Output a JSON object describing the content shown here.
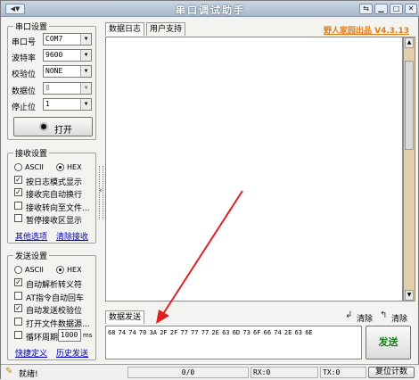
{
  "window": {
    "title": "串口调试助手",
    "sysmenu": "◀▼"
  },
  "serial": {
    "group_title": "串口设置",
    "port_label": "串口号",
    "port_value": "COM7",
    "baud_label": "波特率",
    "baud_value": "9600",
    "parity_label": "校验位",
    "parity_value": "NONE",
    "data_label": "数据位",
    "data_value": "8",
    "stop_label": "停止位",
    "stop_value": "1",
    "open_button": "打开"
  },
  "receive": {
    "group_title": "接收设置",
    "ascii": "ASCII",
    "hex": "HEX",
    "opt1": "按日志模式显示",
    "opt2": "接收完自动换行",
    "opt3": "接收转向至文件...",
    "opt4": "暂停接收区显示",
    "more": "其他选项",
    "clear": "清除接收"
  },
  "send_settings": {
    "group_title": "发送设置",
    "ascii": "ASCII",
    "hex": "HEX",
    "opt1": "自动解析转义符",
    "opt2": "AT指令自动回车",
    "opt3": "自动发送校验位",
    "opt4": "打开文件数据源...",
    "cycle_label": "循环周期",
    "cycle_value": "1000",
    "cycle_unit": "ms",
    "shortcut": "快捷定义",
    "history": "历史发送"
  },
  "tabs": [
    "数据日志",
    "用户支持"
  ],
  "brand": "野人家园出品 V4.3.13",
  "send_panel": {
    "tab": "数据发送",
    "clear_label": "清除",
    "clear2_label": "清除",
    "content": "68 74 74 70 3A 2F 2F 77 77 77 2E 63 6D 73 6F 66 74 2E 63 6E",
    "send_button": "发送"
  },
  "statusbar": {
    "ready": "就绪!",
    "ratio": "0/0",
    "rx": "RX:0",
    "tx": "TX:0",
    "reset": "复位计数"
  },
  "colors": {
    "brand": "#e8790e",
    "arrow": "#e02020",
    "scroll": "#e0cfa8"
  }
}
